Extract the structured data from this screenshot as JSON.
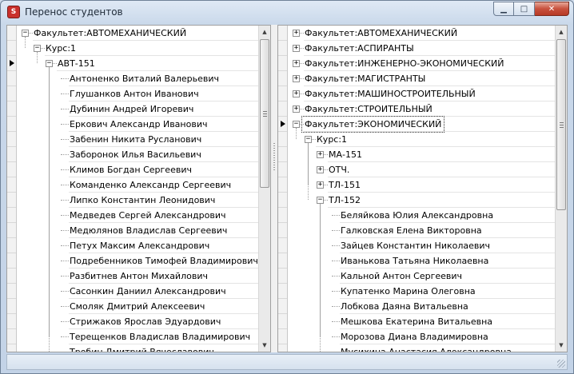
{
  "window": {
    "title": "Перенос студентов",
    "app_icon_glyph": "S"
  },
  "title_buttons": {
    "minimize_glyph": "▁",
    "maximize_glyph": "□",
    "close_glyph": "✕"
  },
  "scroll": {
    "up_glyph": "▲",
    "down_glyph": "▼"
  },
  "expander": {
    "expanded_glyph": "−",
    "collapsed_glyph": "+"
  },
  "left_tree": {
    "current_row": 2,
    "scroll_fraction": 0.0,
    "nodes": [
      {
        "label": "Факультет:АВТОМЕХАНИЧЕСКИЙ",
        "level": 0,
        "state": "expanded"
      },
      {
        "label": "Курс:1",
        "level": 1,
        "state": "expanded"
      },
      {
        "label": "АВТ-151",
        "level": 2,
        "state": "expanded"
      },
      {
        "label": "Антоненко Виталий Валерьевич",
        "level": 3,
        "state": "leaf"
      },
      {
        "label": "Глушанков Антон Иванович",
        "level": 3,
        "state": "leaf"
      },
      {
        "label": "Дубинин Андрей Игоревич",
        "level": 3,
        "state": "leaf"
      },
      {
        "label": "Еркович Александр Иванович",
        "level": 3,
        "state": "leaf"
      },
      {
        "label": "Забенин Никита Русланович",
        "level": 3,
        "state": "leaf"
      },
      {
        "label": "Заборонок Илья Васильевич",
        "level": 3,
        "state": "leaf"
      },
      {
        "label": "Климов Богдан Сергеевич",
        "level": 3,
        "state": "leaf"
      },
      {
        "label": "Команденко Александр Сергеевич",
        "level": 3,
        "state": "leaf"
      },
      {
        "label": "Липко Константин Леонидович",
        "level": 3,
        "state": "leaf"
      },
      {
        "label": "Медведев Сергей Александрович",
        "level": 3,
        "state": "leaf"
      },
      {
        "label": "Медюлянов Владислав Сергеевич",
        "level": 3,
        "state": "leaf"
      },
      {
        "label": "Петух Максим Александрович",
        "level": 3,
        "state": "leaf"
      },
      {
        "label": "Подребенников Тимофей Владимирович",
        "level": 3,
        "state": "leaf"
      },
      {
        "label": "Разбитнев Антон Михайлович",
        "level": 3,
        "state": "leaf"
      },
      {
        "label": "Сасонкин Даниил Александрович",
        "level": 3,
        "state": "leaf"
      },
      {
        "label": "Смоляк Дмитрий Алексеевич",
        "level": 3,
        "state": "leaf"
      },
      {
        "label": "Стрижаков Ярослав Эдуардович",
        "level": 3,
        "state": "leaf"
      },
      {
        "label": "Терещенков Владислав Владимирович",
        "level": 3,
        "state": "leaf"
      },
      {
        "label": "Тробин Дмитрий Вячеславович",
        "level": 3,
        "state": "leaf"
      }
    ]
  },
  "right_tree": {
    "current_row": 6,
    "selected_row": 6,
    "scroll_fraction": 0.0,
    "nodes": [
      {
        "label": "Факультет:АВТОМЕХАНИЧЕСКИЙ",
        "level": 0,
        "state": "collapsed"
      },
      {
        "label": "Факультет:АСПИРАНТЫ",
        "level": 0,
        "state": "collapsed"
      },
      {
        "label": "Факультет:ИНЖЕНЕРНО-ЭКОНОМИЧЕСКИЙ",
        "level": 0,
        "state": "collapsed"
      },
      {
        "label": "Факультет:МАГИСТРАНТЫ",
        "level": 0,
        "state": "collapsed"
      },
      {
        "label": "Факультет:МАШИНОСТРОИТЕЛЬНЫЙ",
        "level": 0,
        "state": "collapsed"
      },
      {
        "label": "Факультет:СТРОИТЕЛЬНЫЙ",
        "level": 0,
        "state": "collapsed"
      },
      {
        "label": "Факультет:ЭКОНОМИЧЕСКИЙ",
        "level": 0,
        "state": "expanded"
      },
      {
        "label": "Курс:1",
        "level": 1,
        "state": "expanded"
      },
      {
        "label": "МА-151",
        "level": 2,
        "state": "collapsed"
      },
      {
        "label": "ОТЧ.",
        "level": 2,
        "state": "collapsed"
      },
      {
        "label": "ТЛ-151",
        "level": 2,
        "state": "collapsed"
      },
      {
        "label": "ТЛ-152",
        "level": 2,
        "state": "expanded"
      },
      {
        "label": "Беляйкова Юлия Александровна",
        "level": 3,
        "state": "leaf"
      },
      {
        "label": "Галковская Елена Викторовна",
        "level": 3,
        "state": "leaf"
      },
      {
        "label": "Зайцев Константин Николаевич",
        "level": 3,
        "state": "leaf"
      },
      {
        "label": "Иванькова Татьяна Николаевна",
        "level": 3,
        "state": "leaf"
      },
      {
        "label": "Кальной Антон Сергеевич",
        "level": 3,
        "state": "leaf"
      },
      {
        "label": "Купатенко Марина Олеговна",
        "level": 3,
        "state": "leaf"
      },
      {
        "label": "Лобкова Даяна Витальевна",
        "level": 3,
        "state": "leaf"
      },
      {
        "label": "Мешкова Екатерина Витальевна",
        "level": 3,
        "state": "leaf"
      },
      {
        "label": "Морозова Диана Владимировна",
        "level": 3,
        "state": "leaf"
      },
      {
        "label": "Мусихина Анастасия Александровна",
        "level": 3,
        "state": "leaf"
      }
    ]
  }
}
